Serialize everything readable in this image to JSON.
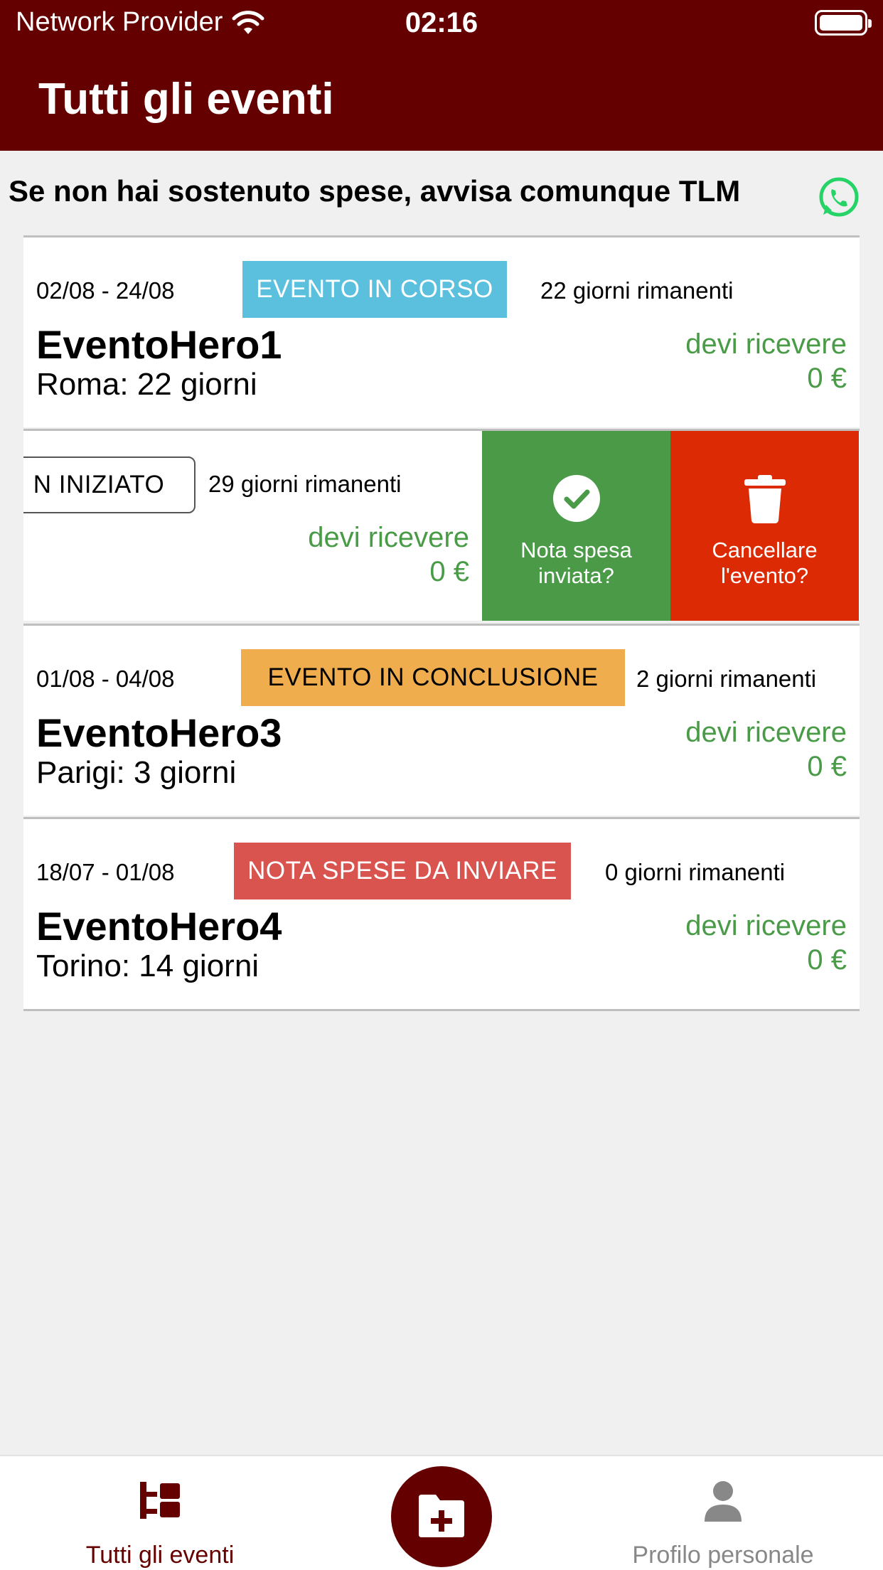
{
  "status_bar": {
    "carrier": "Network Provider",
    "time": "02:16"
  },
  "header": {
    "title": "Tutti gli eventi"
  },
  "notice": {
    "text": "Se non hai sostenuto spese, avvisa comunque TLM",
    "icon": "whatsapp-icon"
  },
  "events": [
    {
      "dates": "02/08 - 24/08",
      "status": "EVENTO IN CORSO",
      "status_color": "#5bc0de",
      "remaining": "22 giorni rimanenti",
      "name": "EventoHero1",
      "city": "Roma: 22 giorni",
      "receive_label": "devi ricevere",
      "amount": "0 €"
    },
    {
      "status": "N INIZIATO",
      "remaining": "29 giorni rimanenti",
      "receive_label": "devi ricevere",
      "amount": "0 €",
      "actions": [
        {
          "label": "Nota spesa inviata?",
          "icon": "check-circle-icon",
          "color": "#4a9a48"
        },
        {
          "label": "Cancellare l'evento?",
          "icon": "trash-icon",
          "color": "#dc2a04"
        }
      ]
    },
    {
      "dates": "01/08 - 04/08",
      "status": "EVENTO IN CONCLUSIONE",
      "status_color": "#f0ad4e",
      "remaining": "2 giorni rimanenti",
      "name": "EventoHero3",
      "city": "Parigi: 3 giorni",
      "receive_label": "devi ricevere",
      "amount": "0 €"
    },
    {
      "dates": "18/07 - 01/08",
      "status": "NOTA SPESE DA INVIARE",
      "status_color": "#d9534f",
      "remaining": "0 giorni rimanenti",
      "name": "EventoHero4",
      "city": "Torino: 14 giorni",
      "receive_label": "devi ricevere",
      "amount": "0 €"
    }
  ],
  "tabbar": {
    "tabs": [
      {
        "label": "Tutti gli eventi",
        "icon": "events-tree-icon",
        "active": true
      },
      {
        "label": "Profilo personale",
        "icon": "person-icon",
        "active": false
      }
    ],
    "fab_icon": "add-folder-icon"
  },
  "colors": {
    "primary": "#650000",
    "positive": "#4a9b47",
    "inactive": "#888888"
  }
}
